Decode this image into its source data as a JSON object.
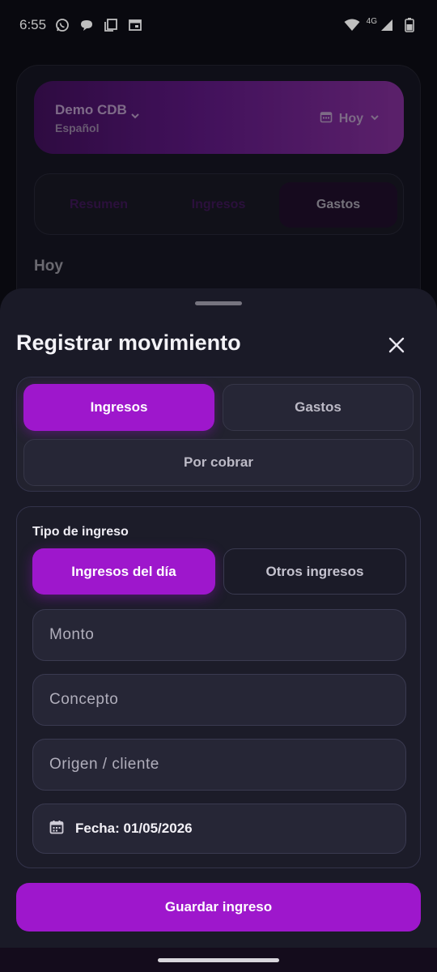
{
  "status_bar": {
    "time": "6:55",
    "network": "4G",
    "icons": [
      "whatsapp-icon",
      "chat-bubble-icon",
      "copy-icon",
      "calendar-window-icon",
      "wifi-icon",
      "signal-icon",
      "battery-icon"
    ]
  },
  "background": {
    "org_name": "Demo CDB",
    "org_language": "Español",
    "date_filter": "Hoy",
    "tabs": [
      {
        "label": "Resumen"
      },
      {
        "label": "Ingresos"
      },
      {
        "label": "Gastos"
      }
    ],
    "section_heading": "Hoy"
  },
  "sheet": {
    "title": "Registrar movimiento",
    "type_options": [
      {
        "label": "Ingresos",
        "selected": true
      },
      {
        "label": "Gastos",
        "selected": false
      },
      {
        "label": "Por cobrar",
        "selected": false
      }
    ],
    "income_type": {
      "label": "Tipo de ingreso",
      "options": [
        {
          "label": "Ingresos del día",
          "selected": true
        },
        {
          "label": "Otros ingresos",
          "selected": false
        }
      ]
    },
    "fields": {
      "monto_placeholder": "Monto",
      "concepto_placeholder": "Concepto",
      "origen_placeholder": "Origen / cliente",
      "fecha_text": "Fecha: 01/05/2026"
    },
    "save_label": "Guardar ingreso"
  },
  "colors": {
    "accent": "#9e17cc",
    "sheet_bg": "#1a1a27",
    "field_bg": "#262636"
  }
}
